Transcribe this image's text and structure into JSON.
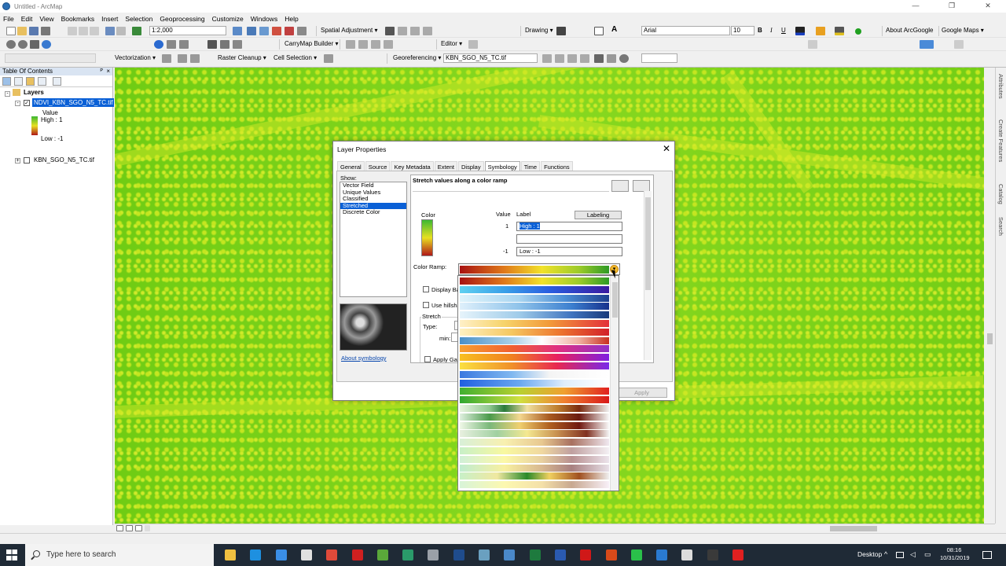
{
  "window": {
    "title": "Untitled - ArcMap",
    "buttons": [
      "—",
      "❐",
      "✕"
    ]
  },
  "menu": [
    "File",
    "Edit",
    "View",
    "Bookmarks",
    "Insert",
    "Selection",
    "Geoprocessing",
    "Customize",
    "Windows",
    "Help"
  ],
  "toolbar1": {
    "scale": "1:2,000",
    "spatial_adjustment": "Spatial Adjustment ▾",
    "drawing": "Drawing ▾",
    "font": "Arial",
    "font_size": "10",
    "bold": "B",
    "italic": "I",
    "underline": "U",
    "about_arcgoogle": "About ArcGoogle",
    "google_maps": "Google Maps ▾"
  },
  "toolbar2": {
    "carrymap": "CarryMap Builder ▾",
    "editor": "Editor ▾"
  },
  "toolbar3": {
    "vectorization": "Vectorization ▾",
    "raster_cleanup": "Raster Cleanup ▾",
    "cell_selection": "Cell Selection ▾",
    "georeferencing": "Georeferencing ▾",
    "geo_layer": "KBN_SGO_N5_TC.tif"
  },
  "toc": {
    "title": "Table Of Contents",
    "pin": "ᴾ",
    "close": "×",
    "root": "Layers",
    "layer1": "NDVI_KBN_SGO_N5_TC.tif",
    "value": "Value",
    "high": "High : 1",
    "low": "Low : -1",
    "layer2": "KBN_SGO_N5_TC.tif"
  },
  "right_dock": [
    "Attributes",
    "Create Features",
    "Catalog",
    "Search"
  ],
  "dialog": {
    "title": "Layer Properties",
    "close": "✕",
    "tabs": [
      "General",
      "Source",
      "Key Metadata",
      "Extent",
      "Display",
      "Symbology",
      "Time",
      "Functions"
    ],
    "active_tab": "Symbology",
    "show_label": "Show:",
    "show_items": [
      "Vector Field",
      "Unique Values",
      "Classified",
      "Stretched",
      "Discrete Color"
    ],
    "selected_show": "Stretched",
    "about_link": "About symbology",
    "heading": "Stretch values along a color ramp",
    "col_color": "Color",
    "col_value": "Value",
    "col_label": "Label",
    "labeling_btn": "Labeling",
    "value_high": "1",
    "value_low": "-1",
    "label_high": "High : 1",
    "label_mid": "",
    "label_low": "Low : -1",
    "color_ramp_label": "Color Ramp:",
    "display_background": "Display Bac",
    "use_hillshade": "Use hillshac",
    "stretch_group": "Stretch",
    "type_label": "Type:",
    "min_label": "min:",
    "apply_gamma": "Apply Gam",
    "apply_btn": "Apply"
  },
  "color_ramps": [
    "linear-gradient(90deg,#a81212,#e07a1a 30%,#f2e22a 55%,#9ccb2a 80%,#2e9a25)",
    "linear-gradient(90deg,#5fd0f0,#3aa0e8 30%,#2a5ee0 60%,#3a1aa0)",
    "linear-gradient(90deg,#dff3fb,#a9d5f0 40%,#4c8fd6 70%,#1d3f8f)",
    "linear-gradient(90deg,#dff0fb,#8fc3ea 40%,#3c7fcf 75%,#16318c)",
    "linear-gradient(90deg,#e6f4fb,#9fcbe9 40%,#3f74bf 75%,#183a7a)",
    "linear-gradient(90deg,#fff0c8,#f6d36a 30%,#f29a3a 60%,#e3303a)",
    "linear-gradient(90deg,#fff2c2,#f5c760 35%,#ee7a30 65%,#d2202a)",
    "linear-gradient(90deg,#4a90c8,#a8d0e8 35%,#ffffff 55%,#f0b0a0 80%,#c83020)",
    "linear-gradient(90deg,#f8a030,#f06030 35%,#e03080 65%,#9030c8)",
    "linear-gradient(90deg,#f8c020,#f08020 35%,#e82060 65%,#8020e0)",
    "linear-gradient(90deg,#fae040,#f0902a 35%,#e82850 65%,#7a28e8)",
    "linear-gradient(90deg,#3a78e0,#80b8f0 35%,#f4f4f4 60%,#ffffff)",
    "linear-gradient(90deg,#2060e0,#6aa8f0 40%,#e0eefc 70%,#ffffff)",
    "linear-gradient(90deg,#40b030,#b8d030 40%,#f0a030 70%,#e02020)",
    "linear-gradient(90deg,#30a830,#d0e040 40%,#f08030 70%,#d81818)",
    "linear-gradient(90deg,#e8f4e0,#90c890 20%,#2a7a3a 30%,#f0e0a0 45%,#c08030 65%,#7a2a10 80%,#f0f0f0)",
    "linear-gradient(90deg,#e0f0e0,#4a9a4a 20%,#f4d890 40%,#a85a20 60%,#6a1a10 80%,#f8f8f8)",
    "linear-gradient(90deg,#f0f8e8,#7ab87a 20%,#f0d070 40%,#b06020 60%,#701810 80%,#fafafa)",
    "linear-gradient(90deg,#e8f0e0,#a0d0a0 25%,#f4e890 45%,#c89050 65%,#803020 85%,#f4f4f4)",
    "linear-gradient(90deg,#d8f0d8,#f8f0b0 30%,#e8c890 55%,#a87060 75%,#f0e8f0)",
    "linear-gradient(90deg,#c8f0c8,#f8f8a0 30%,#f0d8a0 55%,#c0a0a0 75%,#f4f0f4)",
    "linear-gradient(90deg,#d0f0d8,#fcf8a8 30%,#e8d0a0 55%,#b89090 75%,#ece4ec)",
    "linear-gradient(90deg,#c0ecd0,#f8f0a0 30%,#d8b890 55%,#a88080 75%,#e8e0e8)",
    "linear-gradient(90deg,#c8f0c8,#f0e8a0 25%,#2a8a2a 45%,#f0d060 60%,#a05020 80%,#f0f0f0)",
    "linear-gradient(90deg,#d8f4d8,#fcf8b0 30%,#f4e0a8 55%,#c8a890 75%,#f8f0f8)"
  ],
  "taskbar": {
    "search_placeholder": "Type here to search",
    "desktop": "Desktop",
    "time": "08:16",
    "date": "10/31/2019",
    "apps": [
      {
        "name": "file-explorer-icon",
        "color": "#f0c040"
      },
      {
        "name": "edge-icon",
        "color": "#1e90e0"
      },
      {
        "name": "store-icon",
        "color": "#3a8ee6"
      },
      {
        "name": "mail-icon",
        "color": "#e0e0e0"
      },
      {
        "name": "chrome-icon",
        "color": "#e04a3a"
      },
      {
        "name": "acrobat-icon",
        "color": "#d02020"
      },
      {
        "name": "qgis-icon",
        "color": "#5aa83a"
      },
      {
        "name": "app-green-icon",
        "color": "#2a9a6a"
      },
      {
        "name": "app-gray-icon",
        "color": "#9aa0a8"
      },
      {
        "name": "photoshop-icon",
        "color": "#1f4c8c"
      },
      {
        "name": "app-globe-icon",
        "color": "#6aa0c0"
      },
      {
        "name": "arcmap-icon",
        "color": "#4a88c8"
      },
      {
        "name": "excel-icon",
        "color": "#1e7a3e"
      },
      {
        "name": "word-icon",
        "color": "#2a5ab0"
      },
      {
        "name": "opera-icon",
        "color": "#d01818"
      },
      {
        "name": "powerpoint-icon",
        "color": "#d84a1a"
      },
      {
        "name": "whatsapp-icon",
        "color": "#2ac04a"
      },
      {
        "name": "app-blue-icon",
        "color": "#2a7ad0"
      },
      {
        "name": "app-white-icon",
        "color": "#dcdcdc"
      },
      {
        "name": "app-dark-icon",
        "color": "#3a3a3a"
      },
      {
        "name": "recorder-icon",
        "color": "#e02020"
      }
    ]
  }
}
